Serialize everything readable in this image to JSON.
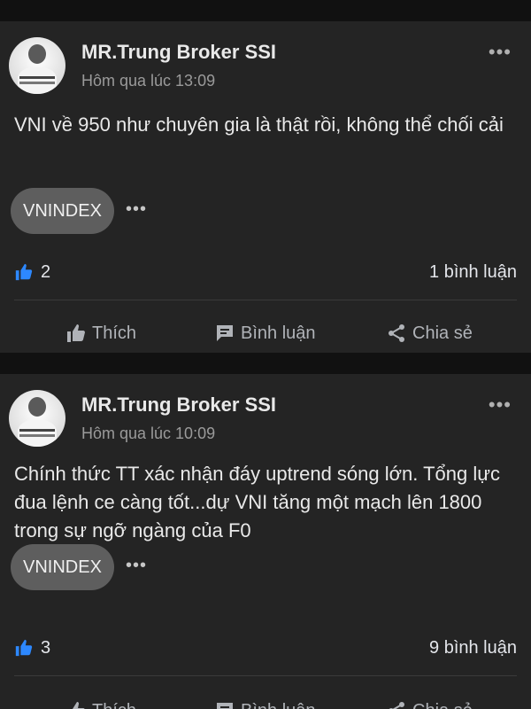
{
  "posts": [
    {
      "author": "MR.Trung Broker SSI",
      "time": "Hôm qua lúc 13:09",
      "content": "VNI về 950 như chuyên gia là thật rồi, không thể chối cải",
      "tag": "VNINDEX",
      "likes": "2",
      "comments": "1 bình luận"
    },
    {
      "author": "MR.Trung Broker SSI",
      "time": "Hôm qua lúc 10:09",
      "content": "Chính thức TT xác nhận đáy uptrend sóng lớn. Tổng lực đua lệnh ce càng tốt...dự VNI tăng một mạch lên 1800 trong sự ngỡ ngàng của F0",
      "tag": "VNINDEX",
      "likes": "3",
      "comments": "9 bình luận"
    }
  ],
  "actions": {
    "like_label": "Thích",
    "comment_label": "Bình luận",
    "share_label": "Chia sẻ"
  },
  "icons": {
    "more": "more-horizontal-icon",
    "like": "thumbs-up-icon",
    "comment": "comment-bubble-icon",
    "share": "share-icon"
  },
  "colors": {
    "background": "#111111",
    "card": "#242424",
    "like_blue": "#2d88ff",
    "tag_bg": "#5e5e5e",
    "muted_text": "#9a9a9a"
  }
}
